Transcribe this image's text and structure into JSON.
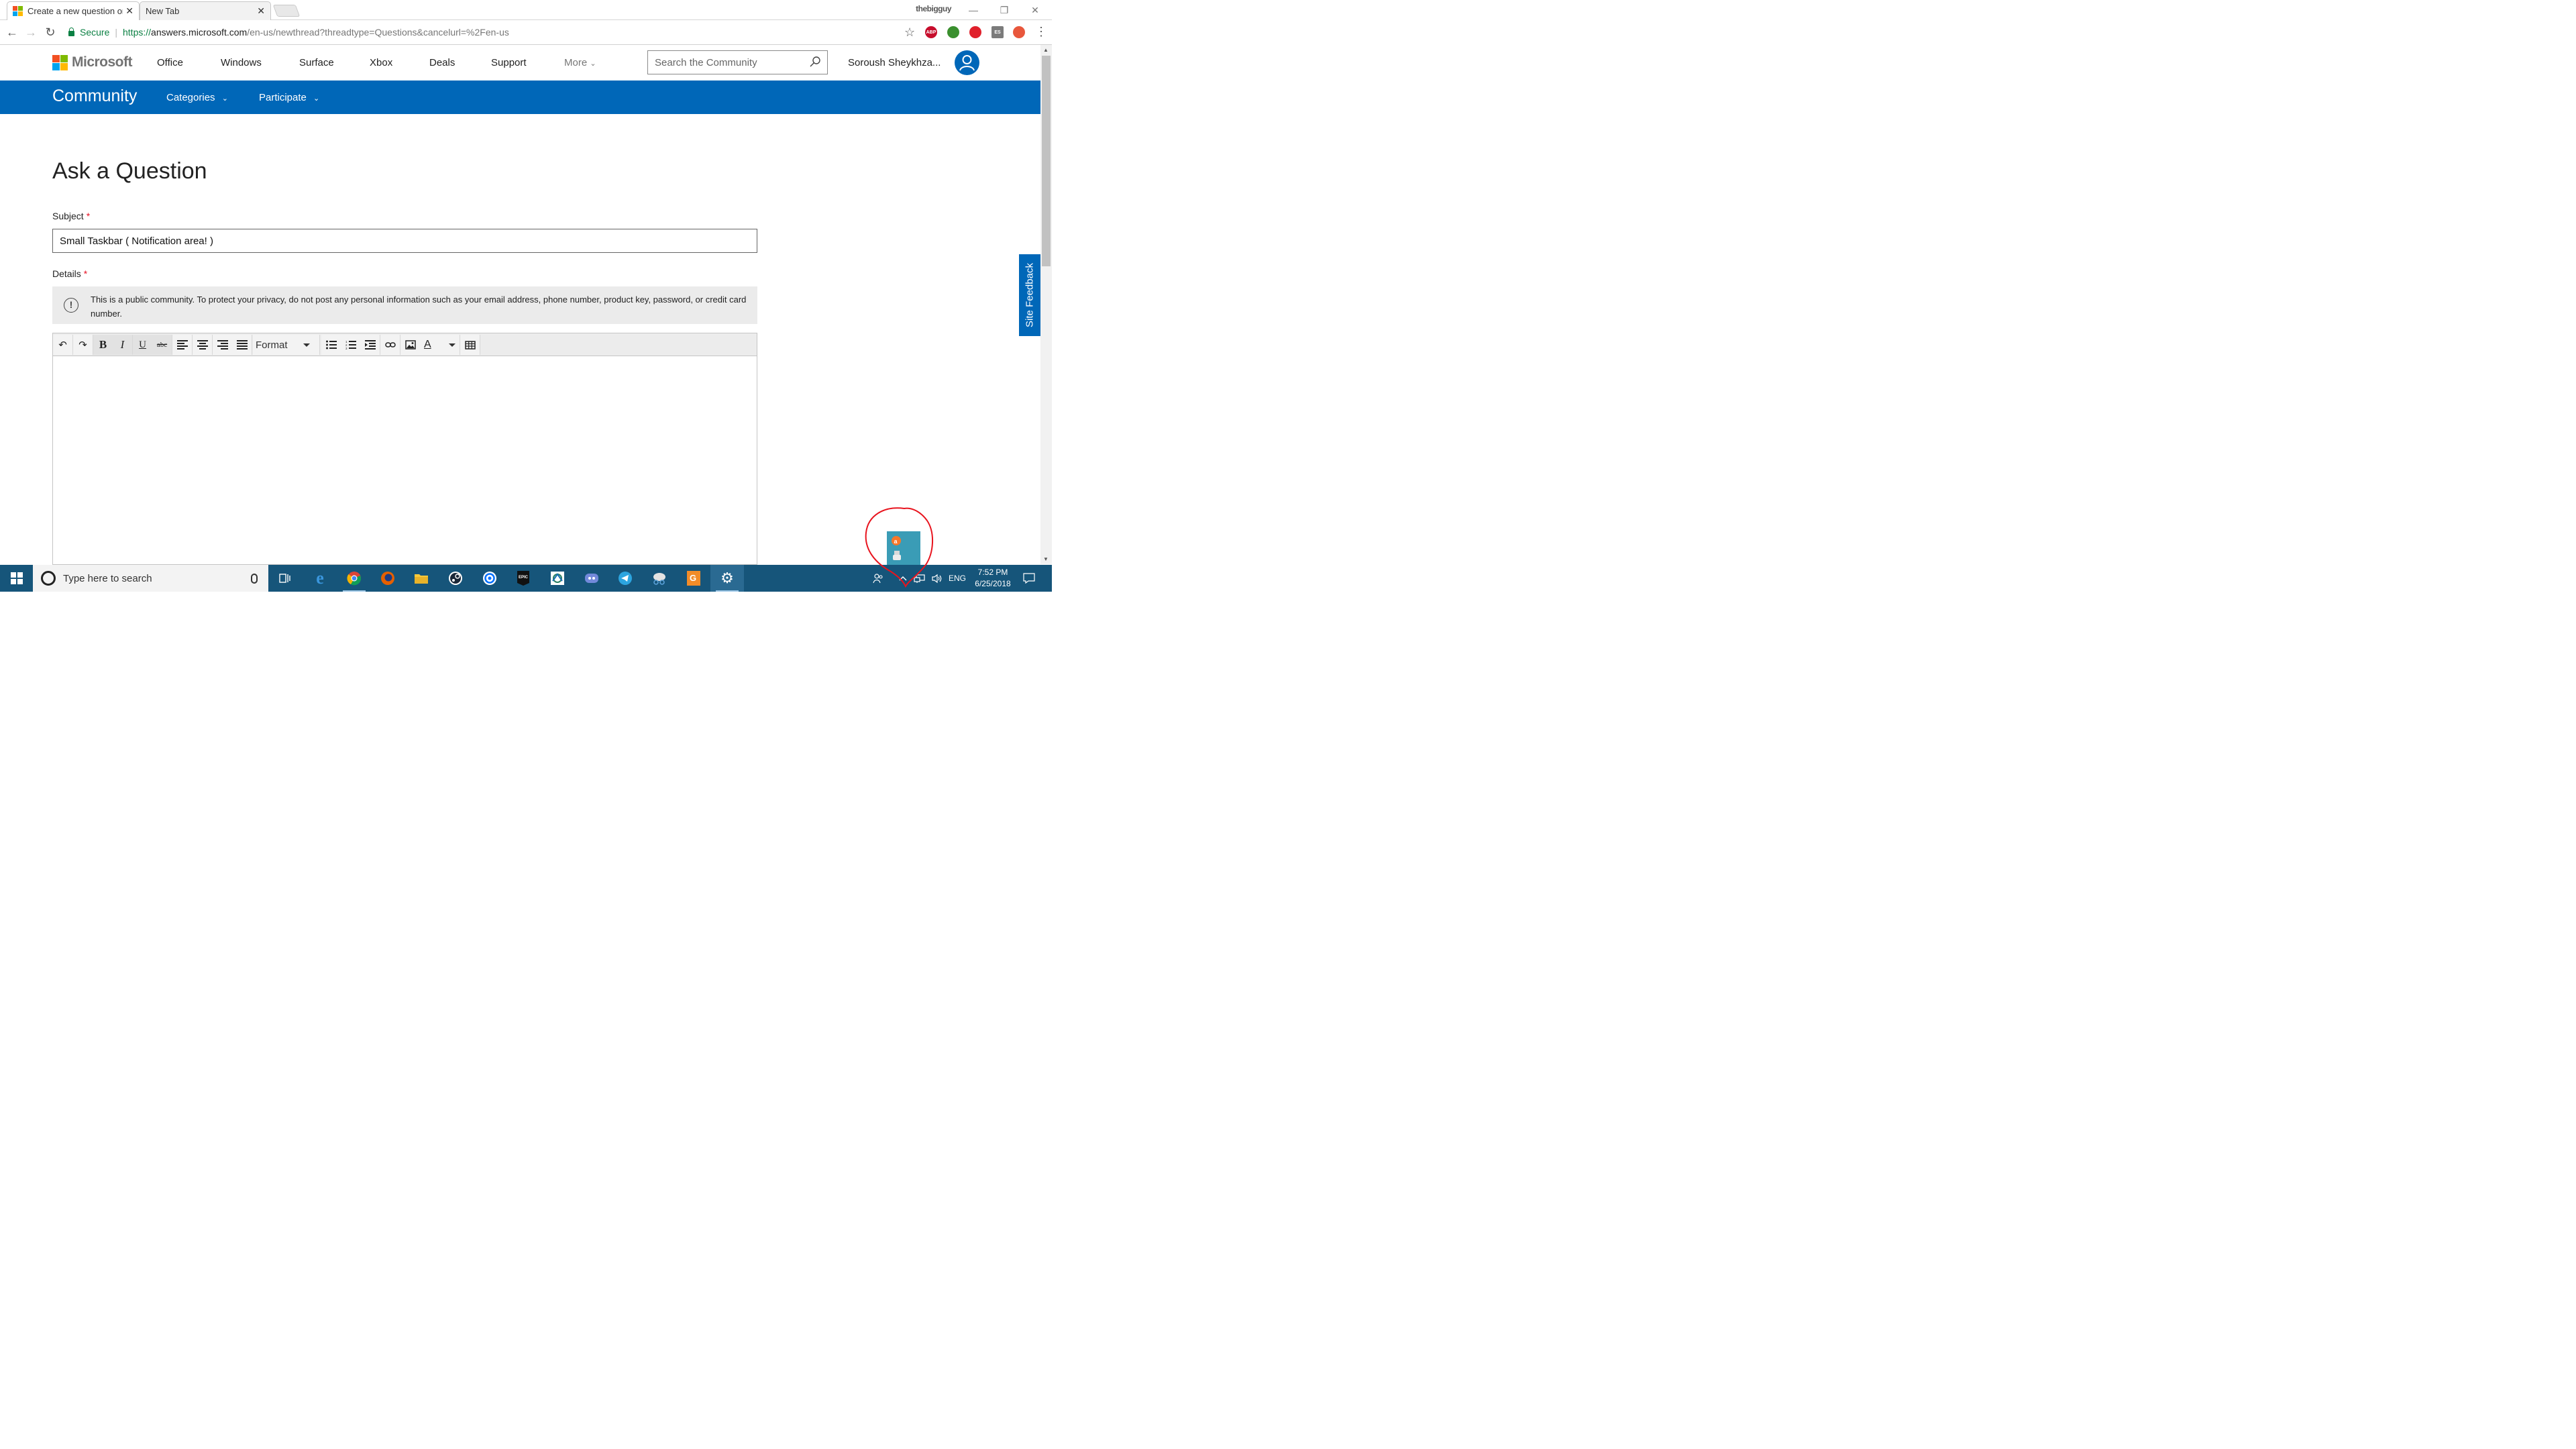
{
  "browser": {
    "tabs": [
      {
        "title": "Create a new question or",
        "active": true
      },
      {
        "title": "New Tab",
        "active": false
      }
    ],
    "profile_name": "thebigguy",
    "secure_label": "Secure",
    "url_scheme": "https://",
    "url_host": "answers.microsoft.com",
    "url_path": "/en-us/newthread?threadtype=Questions&cancelurl=%2Fen-us",
    "extensions": [
      {
        "name": "abp-icon",
        "label": "ABP",
        "color": "#c70d2c"
      },
      {
        "name": "idm-icon",
        "label": "",
        "color": "#3a8f2e"
      },
      {
        "name": "opera-icon",
        "label": "",
        "color": "#e0202b"
      },
      {
        "name": "es-icon",
        "label": "ES",
        "color": "#7b7b7b"
      },
      {
        "name": "shield-ext-icon",
        "label": "",
        "color": "#e8573c"
      }
    ]
  },
  "ms_header": {
    "brand": "Microsoft",
    "nav": [
      "Office",
      "Windows",
      "Surface",
      "Xbox",
      "Deals",
      "Support"
    ],
    "more_label": "More",
    "search_placeholder": "Search the Community",
    "user_name": "Soroush Sheykhza..."
  },
  "community_bar": {
    "title": "Community",
    "nav": [
      "Categories",
      "Participate"
    ]
  },
  "form": {
    "heading": "Ask a Question",
    "subject_label": "Subject",
    "subject_value": "Small Taskbar ( Notification area! )",
    "details_label": "Details",
    "required_mark": "*",
    "privacy_notice": "This is a public community. To protect your privacy, do not post any personal information such as your email address, phone number, product key, password, or credit card number.",
    "editor_toolbar": {
      "format_label": "Format",
      "buttons": [
        "undo-icon",
        "redo-icon",
        "bold-icon",
        "italic-icon",
        "underline-icon",
        "strikethrough-icon",
        "align-left-icon",
        "align-center-icon",
        "align-right-icon",
        "justify-icon",
        "bulleted-list-icon",
        "numbered-list-icon",
        "indent-icon",
        "link-icon",
        "image-icon",
        "text-color-icon",
        "table-icon"
      ]
    }
  },
  "site_feedback": "Site Feedback",
  "taskbar": {
    "search_placeholder": "Type here to search",
    "language": "ENG",
    "time": "7:52 PM",
    "date": "6/25/2018",
    "accent": "#16557a"
  },
  "colors": {
    "ms_blue": "#0067b8",
    "required_red": "#e81123",
    "secure_green": "#0b8043"
  }
}
